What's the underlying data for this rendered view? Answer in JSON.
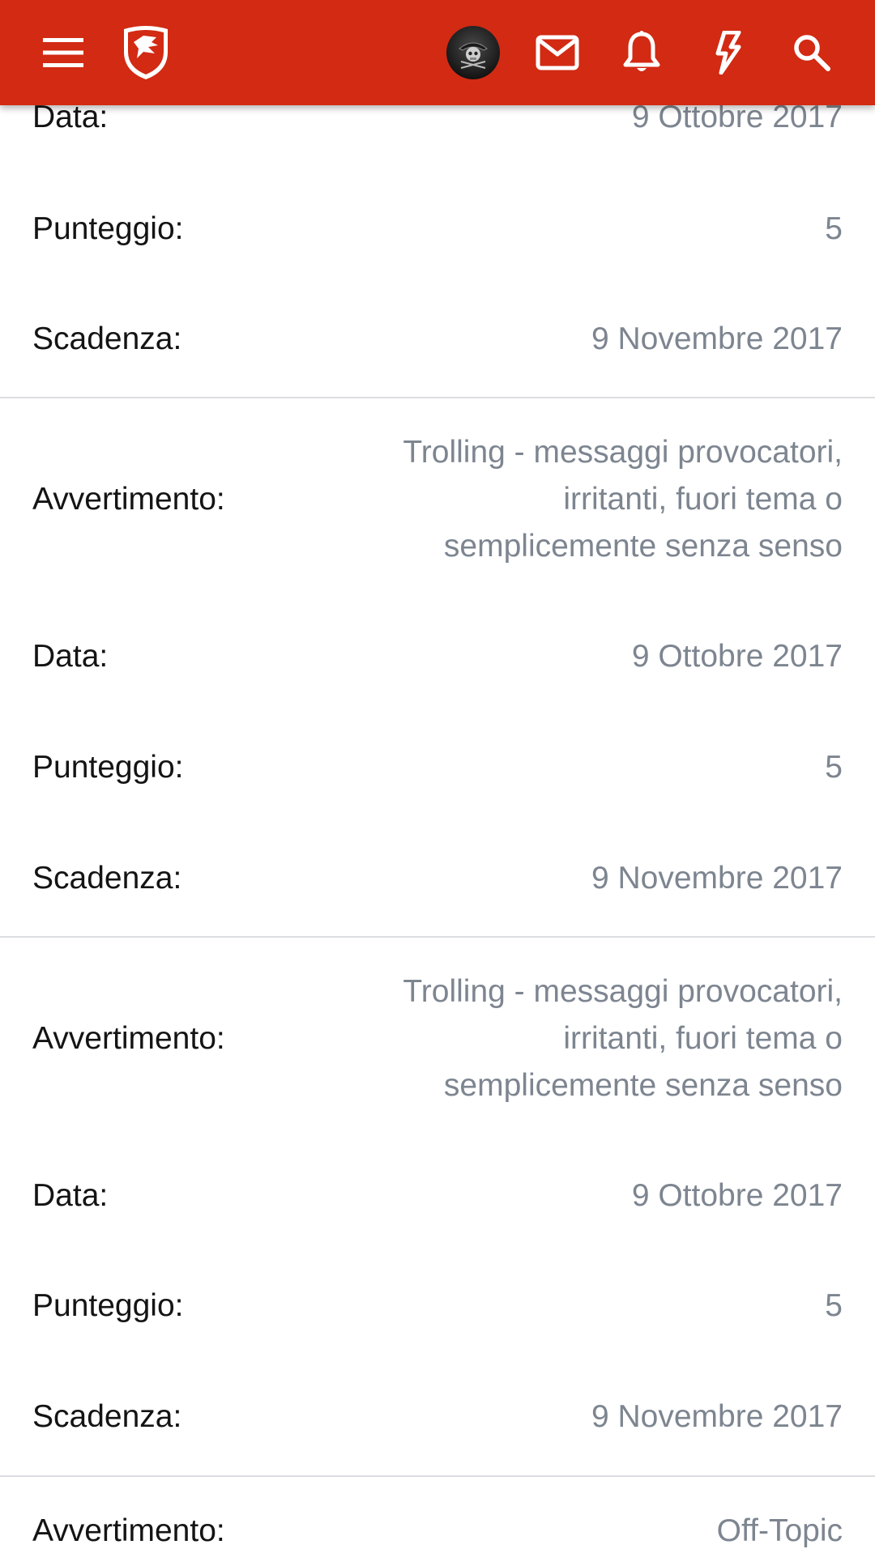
{
  "header": {
    "menu_icon": "menu-icon",
    "logo_icon": "shield-logo-icon",
    "avatar_icon": "pirate-avatar-icon",
    "mail_icon": "mail-icon",
    "bell_icon": "bell-icon",
    "bolt_icon": "bolt-icon",
    "search_icon": "search-icon",
    "accent_color": "#d22a13"
  },
  "warnings": [
    {
      "data_label": "Data:",
      "data_value": "9 Ottobre 2017",
      "score_label": "Punteggio:",
      "score_value": "5",
      "expiry_label": "Scadenza:",
      "expiry_value": "9 Novembre 2017"
    },
    {
      "warning_label": "Avvertimento:",
      "warning_value": "Trolling - messaggi provocatori, irritanti, fuori tema o semplicemente senza senso",
      "data_label": "Data:",
      "data_value": "9 Ottobre 2017",
      "score_label": "Punteggio:",
      "score_value": "5",
      "expiry_label": "Scadenza:",
      "expiry_value": "9 Novembre 2017"
    },
    {
      "warning_label": "Avvertimento:",
      "warning_value": "Trolling - messaggi provocatori, irritanti, fuori tema o semplicemente senza senso",
      "data_label": "Data:",
      "data_value": "9 Ottobre 2017",
      "score_label": "Punteggio:",
      "score_value": "5",
      "expiry_label": "Scadenza:",
      "expiry_value": "9 Novembre 2017"
    },
    {
      "warning_label": "Avvertimento:",
      "warning_value": "Off-Topic"
    }
  ]
}
